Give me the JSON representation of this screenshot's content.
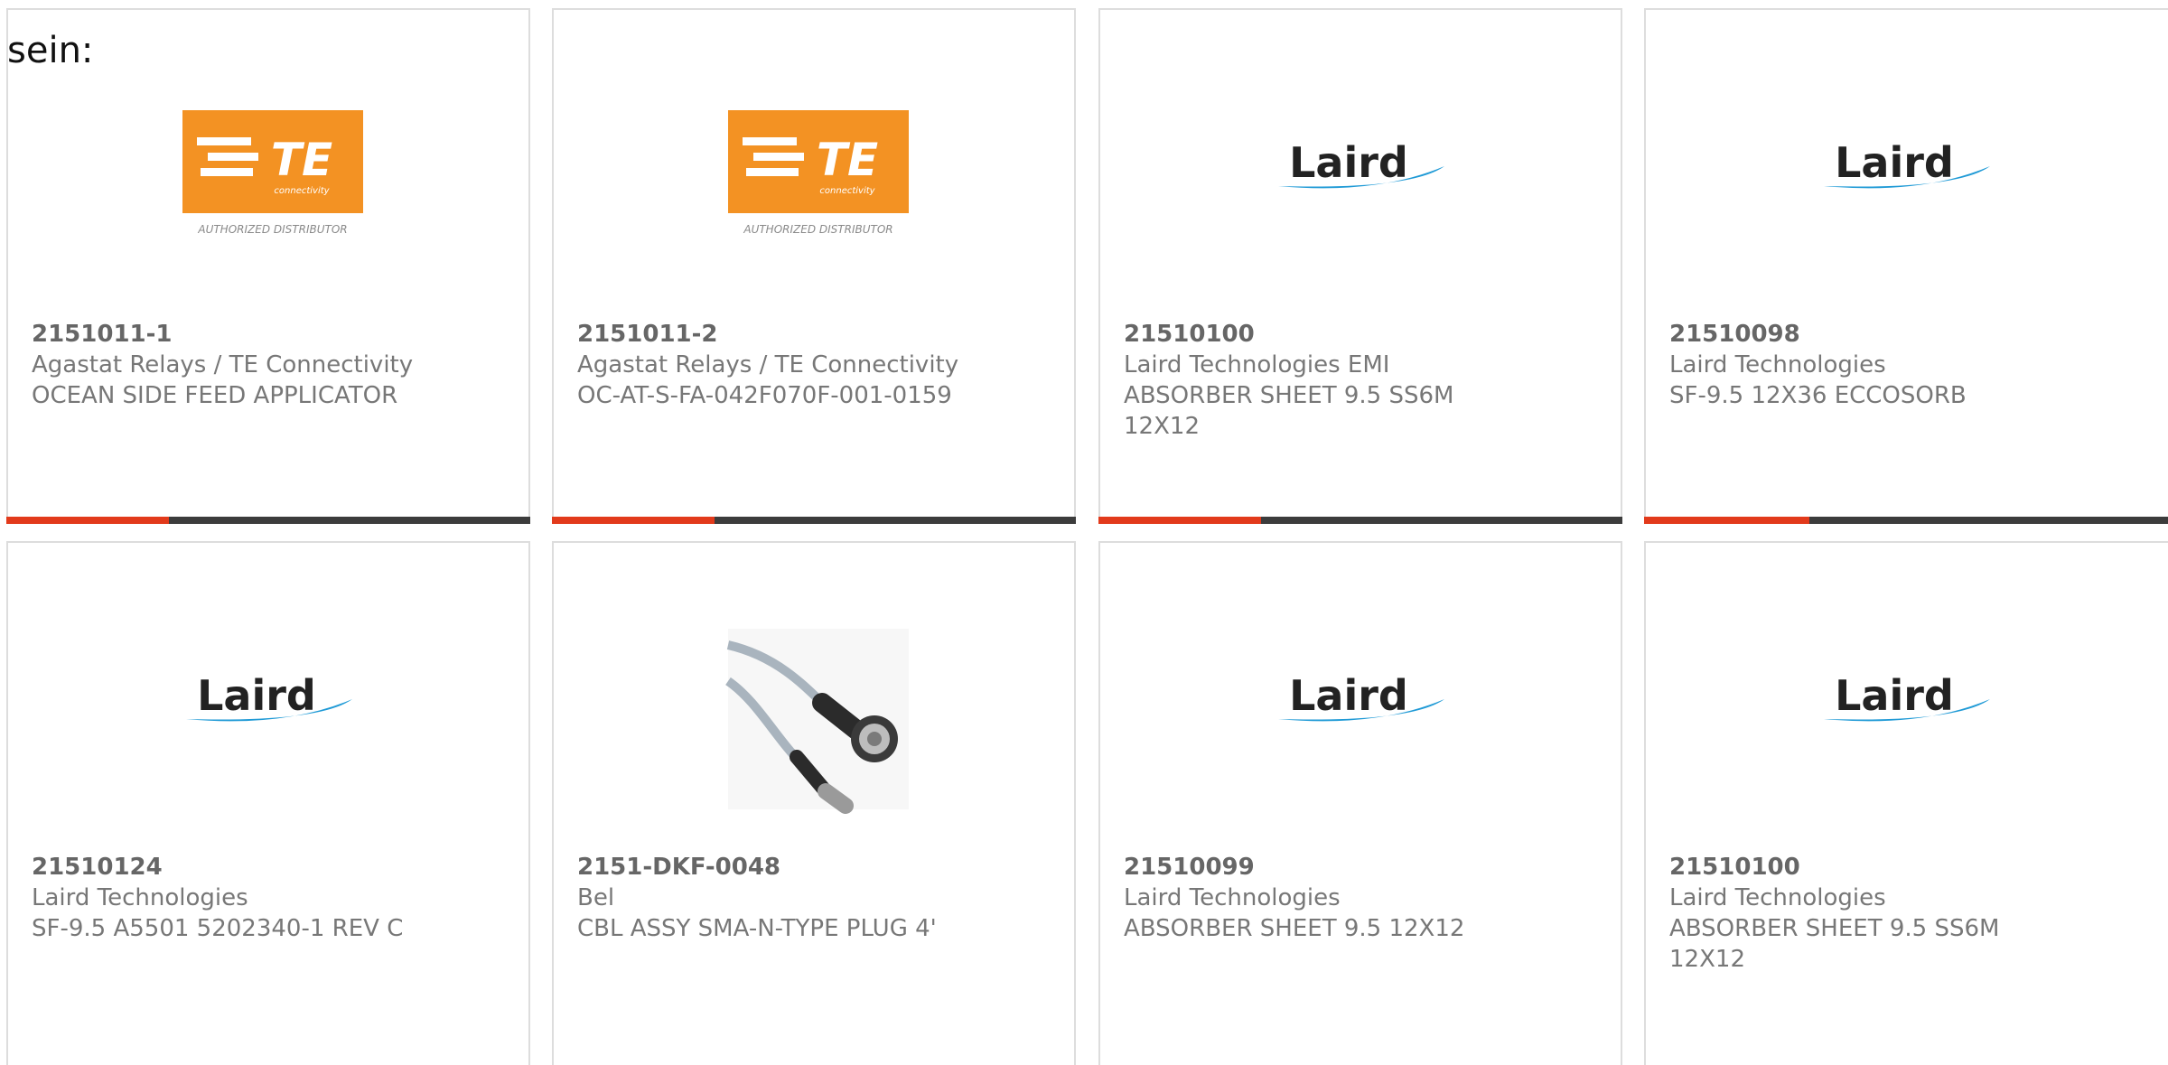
{
  "intro_text": "sein:",
  "colors": {
    "progress_fill": "#e23a1b",
    "progress_track": "#3c3c3c",
    "te_orange": "#f39223",
    "laird_blue": "#1f9ad6"
  },
  "products": [
    {
      "part_number": "2151011-1",
      "manufacturer": "Agastat Relays / TE Connectivity",
      "description": "OCEAN SIDE FEED APPLICATOR",
      "image": "te-connectivity-logo",
      "logo_text": "TE",
      "logo_subtext": "connectivity",
      "logo_caption": "AUTHORIZED DISTRIBUTOR",
      "progress": 0.31
    },
    {
      "part_number": "2151011-2",
      "manufacturer": "Agastat Relays / TE Connectivity",
      "description": "OC-AT-S-FA-042F070F-001-0159",
      "image": "te-connectivity-logo",
      "logo_text": "TE",
      "logo_subtext": "connectivity",
      "logo_caption": "AUTHORIZED DISTRIBUTOR",
      "progress": 0.31
    },
    {
      "part_number": "21510100",
      "manufacturer": "Laird Technologies EMI",
      "description": "ABSORBER SHEET 9.5 SS6M\n12X12",
      "image": "laird-logo",
      "logo_text": "Laird",
      "progress": 0.31
    },
    {
      "part_number": "21510098",
      "manufacturer": "Laird Technologies",
      "description": "SF-9.5 12X36 ECCOSORB",
      "image": "laird-logo",
      "logo_text": "Laird",
      "progress": 0.31
    },
    {
      "part_number": "21510124",
      "manufacturer": "Laird Technologies",
      "description": "SF-9.5 A5501 5202340-1 REV C",
      "image": "laird-logo",
      "logo_text": "Laird"
    },
    {
      "part_number": "2151-DKF-0048",
      "manufacturer": "Bel",
      "description": "CBL ASSY SMA-N-TYPE PLUG 4'",
      "image": "cable-assembly-photo"
    },
    {
      "part_number": "21510099",
      "manufacturer": "Laird Technologies",
      "description": "ABSORBER SHEET 9.5 12X12",
      "image": "laird-logo",
      "logo_text": "Laird"
    },
    {
      "part_number": "21510100",
      "manufacturer": "Laird Technologies",
      "description": "ABSORBER SHEET 9.5 SS6M\n12X12",
      "image": "laird-logo",
      "logo_text": "Laird"
    }
  ]
}
